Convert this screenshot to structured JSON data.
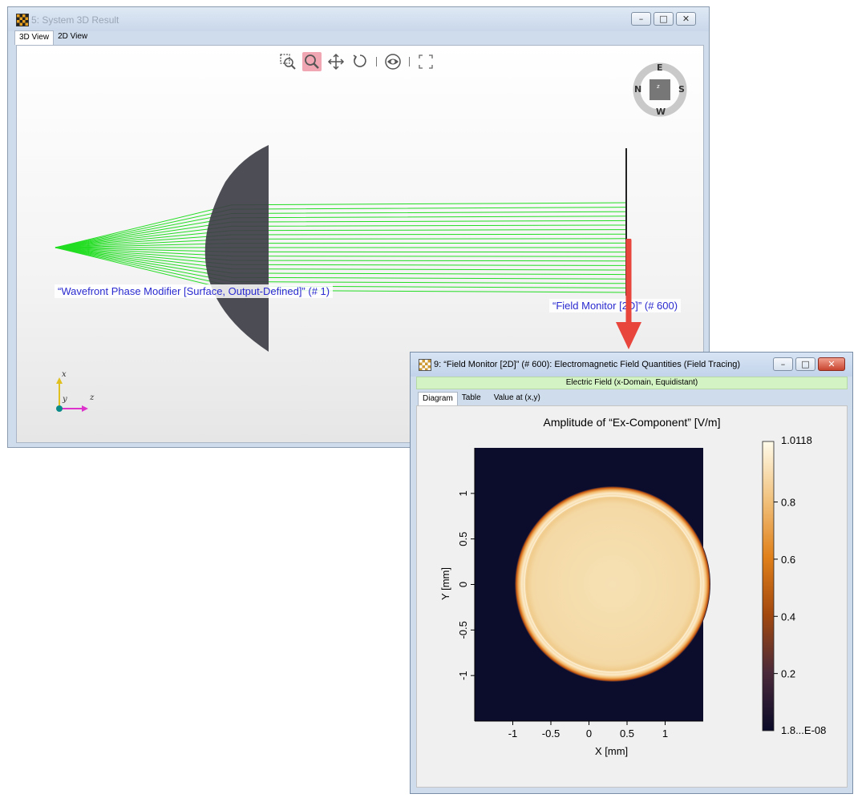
{
  "window_3d": {
    "title": "5: System 3D Result",
    "tabs": [
      {
        "label": "3D View"
      },
      {
        "label": "2D View"
      }
    ],
    "toolbar_icons": [
      "zoom-region-icon",
      "zoom-icon",
      "pan-icon",
      "rotate-icon",
      "view-icon",
      "fullscreen-icon"
    ],
    "compass": {
      "north": "N",
      "east": "E",
      "south": "S",
      "west": "W",
      "center": "z"
    },
    "labels": {
      "wavefront": "“Wavefront Phase Modifier [Surface, Output-Defined]” (# 1)",
      "field_monitor": "“Field Monitor [2D]” (# 600)"
    },
    "axes": {
      "x": "x",
      "y": "y",
      "z": "z"
    },
    "colors": {
      "rays": "#22dd22",
      "lens": "#3c3c44",
      "arrow": "#e8453c"
    }
  },
  "window_field": {
    "title": "9: “Field Monitor [2D]” (# 600): Electromagnetic Field Quantities (Field Tracing)",
    "subtitle": "Electric Field (x-Domain, Equidistant)",
    "tabs": [
      {
        "label": "Diagram"
      },
      {
        "label": "Table"
      },
      {
        "label": "Value at (x,y)"
      }
    ]
  },
  "chart_data": {
    "type": "heatmap",
    "title": "Amplitude of “Ex-Component”  [V/m]",
    "xlabel": "X [mm]",
    "ylabel": "Y [mm]",
    "xlim": [
      -1.5,
      1.5
    ],
    "ylim": [
      -1.5,
      1.5
    ],
    "x_ticks": [
      "-1",
      "-0.5",
      "0",
      "0.5",
      "1"
    ],
    "y_ticks": [
      "-1",
      "-0.5",
      "0",
      "0.5",
      "1"
    ],
    "colorbar": {
      "max_label": "1.0118",
      "min_label": "1.8...E-08",
      "ticks": [
        "0.8",
        "0.6",
        "0.4",
        "0.2"
      ]
    },
    "distribution": "uniform circular disk of amplitude ~0.95 with bright rim, radius ~1.0 mm, zero outside"
  }
}
